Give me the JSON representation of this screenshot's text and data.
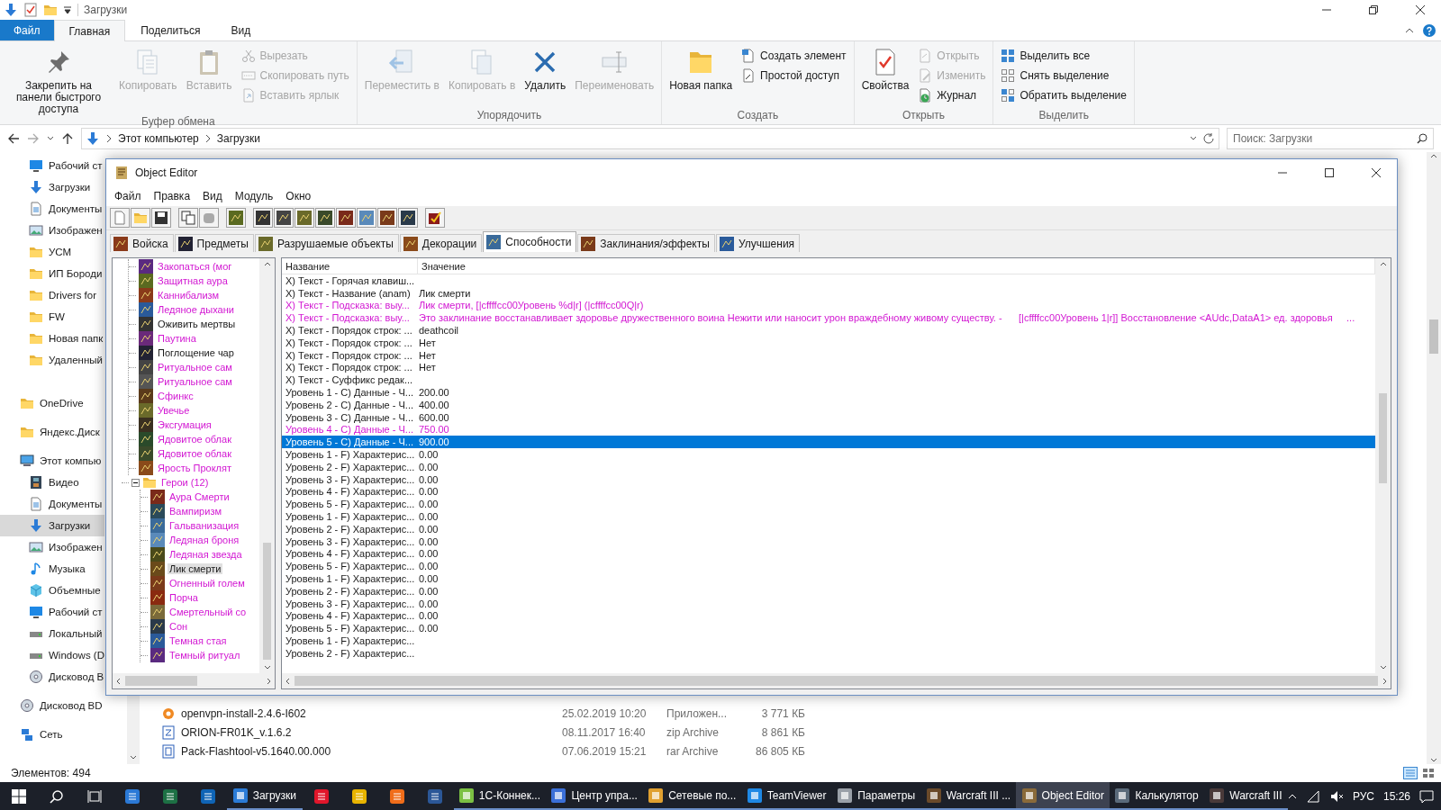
{
  "explorer": {
    "title": "Загрузки",
    "ribbon_tabs": [
      {
        "label": "Файл",
        "kind": "file",
        "selected": false
      },
      {
        "label": "Главная",
        "kind": "tab",
        "selected": true
      },
      {
        "label": "Поделиться",
        "kind": "tab",
        "selected": false
      },
      {
        "label": "Вид",
        "kind": "tab",
        "selected": false
      }
    ],
    "ribbon_groups": [
      {
        "label": "Буфер обмена",
        "buttons": [
          {
            "label": "Закрепить на панели быстрого доступа",
            "kind": "large",
            "disabled": false
          },
          {
            "label": "Копировать",
            "kind": "large",
            "disabled": true
          },
          {
            "label": "Вставить",
            "kind": "large",
            "disabled": true
          },
          {
            "label": "Вырезать",
            "kind": "small",
            "disabled": true
          },
          {
            "label": "Скопировать путь",
            "kind": "small",
            "disabled": true
          },
          {
            "label": "Вставить ярлык",
            "kind": "small",
            "disabled": true
          }
        ]
      },
      {
        "label": "Упорядочить",
        "buttons": [
          {
            "label": "Переместить в",
            "kind": "large",
            "disabled": true
          },
          {
            "label": "Копировать в",
            "kind": "large",
            "disabled": true
          },
          {
            "label": "Удалить",
            "kind": "large",
            "disabled": false
          },
          {
            "label": "Переименовать",
            "kind": "large",
            "disabled": true
          }
        ]
      },
      {
        "label": "Создать",
        "buttons": [
          {
            "label": "Новая папка",
            "kind": "large",
            "disabled": false
          },
          {
            "label": "Создать элемент",
            "kind": "small",
            "disabled": false
          },
          {
            "label": "Простой доступ",
            "kind": "small",
            "disabled": false
          }
        ]
      },
      {
        "label": "Открыть",
        "buttons": [
          {
            "label": "Свойства",
            "kind": "large",
            "disabled": false
          },
          {
            "label": "Открыть",
            "kind": "small",
            "disabled": true
          },
          {
            "label": "Изменить",
            "kind": "small",
            "disabled": true
          },
          {
            "label": "Журнал",
            "kind": "small",
            "disabled": false
          }
        ]
      },
      {
        "label": "Выделить",
        "buttons": [
          {
            "label": "Выделить все",
            "kind": "small",
            "disabled": false
          },
          {
            "label": "Снять выделение",
            "kind": "small",
            "disabled": false
          },
          {
            "label": "Обратить выделение",
            "kind": "small",
            "disabled": false
          }
        ]
      }
    ],
    "path": [
      "Этот компьютер",
      "Загрузки"
    ],
    "search": {
      "placeholder": "Поиск: Загрузки"
    },
    "nav": [
      {
        "children": [
          {
            "label": "Рабочий ст",
            "kind": "desktop",
            "selected": false
          },
          {
            "label": "Загрузки",
            "kind": "download",
            "selected": false
          },
          {
            "label": "Документы",
            "kind": "documents",
            "selected": false
          },
          {
            "label": "Изображен",
            "kind": "pictures",
            "selected": false
          },
          {
            "label": "УСМ",
            "kind": "folder",
            "selected": false
          },
          {
            "label": "ИП Бороди",
            "kind": "folder",
            "selected": false
          },
          {
            "label": "Drivers for",
            "kind": "folder",
            "selected": false
          },
          {
            "label": "FW",
            "kind": "folder",
            "selected": false
          },
          {
            "label": "Новая папк",
            "kind": "folder",
            "selected": false
          },
          {
            "label": "Удаленный",
            "kind": "folder",
            "selected": false
          }
        ]
      },
      {
        "label": "OneDrive",
        "kind": "folder",
        "selected": false
      },
      {
        "label": "Яндекс.Диск",
        "kind": "folder",
        "selected": false
      },
      {
        "label": "Этот компью",
        "kind": "computer",
        "selected": false,
        "children": [
          {
            "label": "Видео",
            "kind": "video",
            "selected": false
          },
          {
            "label": "Документы",
            "kind": "documents",
            "selected": false
          },
          {
            "label": "Загрузки",
            "kind": "download",
            "selected": true
          },
          {
            "label": "Изображен",
            "kind": "pictures",
            "selected": false
          },
          {
            "label": "Музыка",
            "kind": "music",
            "selected": false
          },
          {
            "label": "Объемные",
            "kind": "objects",
            "selected": false
          },
          {
            "label": "Рабочий ст",
            "kind": "desktop",
            "selected": false
          },
          {
            "label": "Локальный",
            "kind": "drive",
            "selected": false
          },
          {
            "label": "Windows (D",
            "kind": "drive",
            "selected": false
          },
          {
            "label": "Дисковод B",
            "kind": "disc",
            "selected": false
          }
        ]
      },
      {
        "label": "Дисковод BD",
        "kind": "disc",
        "selected": false
      },
      {
        "label": "Сеть",
        "kind": "network",
        "selected": false
      }
    ],
    "files": [
      {
        "name": "openvpn-install-2.4.6-I602",
        "date": "25.02.2019 10:20",
        "type": "Приложен...",
        "size": "3 771 КБ",
        "kind": "installer"
      },
      {
        "name": "ORION-FR01K_v.1.6.2",
        "date": "08.11.2017 16:40",
        "type": "zip Archive",
        "size": "8 861 КБ",
        "kind": "zip"
      },
      {
        "name": "Pack-Flashtool-v5.1640.00.000",
        "date": "07.06.2019 15:21",
        "type": "rar Archive",
        "size": "86 805 КБ",
        "kind": "rar"
      }
    ],
    "status": "Элементов: 494"
  },
  "editor": {
    "title": "Object Editor",
    "menu": [
      "Файл",
      "Правка",
      "Вид",
      "Модуль",
      "Окно"
    ],
    "tabs": [
      {
        "label": "Войска",
        "selected": false
      },
      {
        "label": "Предметы",
        "selected": false
      },
      {
        "label": "Разрушаемые объекты",
        "selected": false
      },
      {
        "label": "Декорации",
        "selected": false
      },
      {
        "label": "Способности",
        "selected": true
      },
      {
        "label": "Заклинания/эффекты",
        "selected": false
      },
      {
        "label": "Улучшения",
        "selected": false
      }
    ],
    "tree": [
      {
        "children": [
          {
            "label": "Закопаться (мог",
            "modified": true,
            "selected": false
          },
          {
            "label": "Защитная аура",
            "modified": true,
            "selected": false
          },
          {
            "label": "Каннибализм",
            "modified": true,
            "selected": false
          },
          {
            "label": "Ледяное дыхани",
            "modified": true,
            "selected": false
          },
          {
            "label": "Оживить мертвы",
            "modified": false,
            "selected": false
          },
          {
            "label": "Паутина",
            "modified": true,
            "selected": false
          },
          {
            "label": "Поглощение чар",
            "modified": false,
            "selected": false
          },
          {
            "label": "Ритуальное сам",
            "modified": true,
            "selected": false
          },
          {
            "label": "Ритуальное сам",
            "modified": true,
            "selected": false
          },
          {
            "label": "Сфинкс",
            "modified": true,
            "selected": false
          },
          {
            "label": "Увечье",
            "modified": true,
            "selected": false
          },
          {
            "label": "Эксгумация",
            "modified": true,
            "selected": false
          },
          {
            "label": "Ядовитое облак",
            "modified": true,
            "selected": false
          },
          {
            "label": "Ядовитое облак",
            "modified": true,
            "selected": false
          },
          {
            "label": "Ярость Проклят",
            "modified": true,
            "selected": false
          }
        ]
      },
      {
        "label": "Герои (12)",
        "modified": true,
        "selected": false,
        "expanded": true,
        "children": [
          {
            "label": "Аура Смерти",
            "modified": true,
            "selected": false
          },
          {
            "label": "Вампиризм",
            "modified": true,
            "selected": false
          },
          {
            "label": "Гальванизация",
            "modified": true,
            "selected": false
          },
          {
            "label": "Ледяная броня",
            "modified": true,
            "selected": false
          },
          {
            "label": "Ледяная звезда",
            "modified": true,
            "selected": false
          },
          {
            "label": "Лик смерти",
            "modified": false,
            "selected": true
          },
          {
            "label": "Огненный голем",
            "modified": true,
            "selected": false
          },
          {
            "label": "Порча",
            "modified": true,
            "selected": false
          },
          {
            "label": "Смертельный со",
            "modified": true,
            "selected": false
          },
          {
            "label": "Сон",
            "modified": true,
            "selected": false
          },
          {
            "label": "Темная стая",
            "modified": true,
            "selected": false
          },
          {
            "label": "Темный ритуал",
            "modified": true,
            "selected": false
          }
        ]
      }
    ],
    "table": {
      "columns": [
        "Название",
        "Значение"
      ],
      "rows": [
        {
          "name": "X) Текст - Горячая клавиш...",
          "modified": false,
          "selected": false
        },
        {
          "name": "X) Текст - Название (anam)",
          "value": "Лик смерти",
          "modified": false,
          "selected": false
        },
        {
          "name": "X) Текст - Подсказка: выу...",
          "value": "Лик смерти, [|cffffcc00Уровень %d|r] (|cffffcc00Q|r)",
          "modified": true,
          "selected": false
        },
        {
          "name": "X) Текст - Подсказка: выу...",
          "value": "Это заклинание восстанавливает здоровье дружественного воина Нежити или наносит урон враждебному живому существу. -      [|cffffcc00Уровень 1|r]] Восстановление <AUdc,DataA1> ед. здоровья     ...",
          "modified": true,
          "selected": false
        },
        {
          "name": "X) Текст - Порядок строк: ...",
          "value": "deathcoil",
          "modified": false,
          "selected": false
        },
        {
          "name": "X) Текст - Порядок строк: ...",
          "value": "Нет",
          "modified": false,
          "selected": false
        },
        {
          "name": "X) Текст - Порядок строк: ...",
          "value": "Нет",
          "modified": false,
          "selected": false
        },
        {
          "name": "X) Текст - Порядок строк: ...",
          "value": "Нет",
          "modified": false,
          "selected": false
        },
        {
          "name": "X) Текст - Суффикс редак...",
          "modified": false,
          "selected": false
        },
        {
          "name": "Уровень 1 - C) Данные - Ч...",
          "value": "200.00",
          "modified": false,
          "selected": false
        },
        {
          "name": "Уровень 2 - C) Данные - Ч...",
          "value": "400.00",
          "modified": false,
          "selected": false
        },
        {
          "name": "Уровень 3 - C) Данные - Ч...",
          "value": "600.00",
          "modified": false,
          "selected": false
        },
        {
          "name": "Уровень 4 - C) Данные - Ч...",
          "value": "750.00",
          "modified": true,
          "selected": false
        },
        {
          "name": "Уровень 5 - C) Данные - Ч...",
          "value": "900.00",
          "modified": false,
          "selected": true
        },
        {
          "name": "Уровень 1 - F) Характерис...",
          "value": "0.00",
          "modified": false,
          "selected": false
        },
        {
          "name": "Уровень 2 - F) Характерис...",
          "value": "0.00",
          "modified": false,
          "selected": false
        },
        {
          "name": "Уровень 3 - F) Характерис...",
          "value": "0.00",
          "modified": false,
          "selected": false
        },
        {
          "name": "Уровень 4 - F) Характерис...",
          "value": "0.00",
          "modified": false,
          "selected": false
        },
        {
          "name": "Уровень 5 - F) Характерис...",
          "value": "0.00",
          "modified": false,
          "selected": false
        },
        {
          "name": "Уровень 1 - F) Характерис...",
          "value": "0.00",
          "modified": false,
          "selected": false
        },
        {
          "name": "Уровень 2 - F) Характерис...",
          "value": "0.00",
          "modified": false,
          "selected": false
        },
        {
          "name": "Уровень 3 - F) Характерис...",
          "value": "0.00",
          "modified": false,
          "selected": false
        },
        {
          "name": "Уровень 4 - F) Характерис...",
          "value": "0.00",
          "modified": false,
          "selected": false
        },
        {
          "name": "Уровень 5 - F) Характерис...",
          "value": "0.00",
          "modified": false,
          "selected": false
        },
        {
          "name": "Уровень 1 - F) Характерис...",
          "value": "0.00",
          "modified": false,
          "selected": false
        },
        {
          "name": "Уровень 2 - F) Характерис...",
          "value": "0.00",
          "modified": false,
          "selected": false
        },
        {
          "name": "Уровень 3 - F) Характерис...",
          "value": "0.00",
          "modified": false,
          "selected": false
        },
        {
          "name": "Уровень 4 - F) Характерис...",
          "value": "0.00",
          "modified": false,
          "selected": false
        },
        {
          "name": "Уровень 5 - F) Характерис...",
          "value": "0.00",
          "modified": false,
          "selected": false
        },
        {
          "name": "Уровень 1 - F) Характерис...",
          "modified": false,
          "selected": false
        },
        {
          "name": "Уровень 2 - F) Характерис...",
          "modified": false,
          "selected": false
        }
      ]
    }
  },
  "taskbar": {
    "items": [
      {
        "kind": "pinned",
        "active": false
      },
      {
        "kind": "pinned",
        "active": false
      },
      {
        "kind": "pinned",
        "active": false
      },
      {
        "kind": "app",
        "label": "Загрузки",
        "active": false
      },
      {
        "kind": "pinned",
        "active": false
      },
      {
        "kind": "pinned",
        "active": false
      },
      {
        "kind": "pinned",
        "active": false
      },
      {
        "kind": "pinned",
        "active": false
      },
      {
        "kind": "app",
        "label": "1С-Коннек...",
        "active": false
      },
      {
        "kind": "app",
        "label": "Центр упра...",
        "active": false
      },
      {
        "kind": "app",
        "label": "Сетевые по...",
        "active": false
      },
      {
        "kind": "app",
        "label": "TeamViewer",
        "active": false
      },
      {
        "kind": "app",
        "label": "Параметры",
        "active": false
      },
      {
        "kind": "app",
        "label": "Warcraft III ...",
        "active": false
      },
      {
        "kind": "app",
        "label": "Object Editor",
        "active": true
      },
      {
        "kind": "app",
        "label": "Калькулятор",
        "active": false
      },
      {
        "kind": "app",
        "label": "Warcraft III",
        "active": false
      }
    ],
    "language": "РУС",
    "time": "15:26"
  }
}
